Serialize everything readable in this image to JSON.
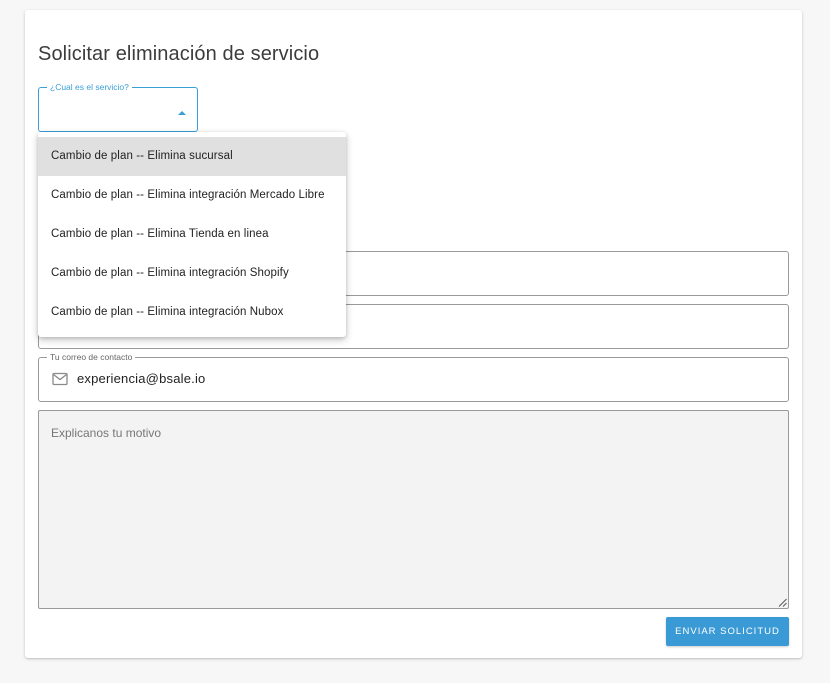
{
  "form": {
    "title": "Solicitar eliminación de servicio",
    "service_label": "¿Cual es el servicio?",
    "service_value": "",
    "field_a_value": "",
    "field_b_value": "",
    "email_label": "Tu correo de contacto",
    "email_value": "experiencia@bsale.io",
    "reason_placeholder": "Explicanos tu motivo",
    "submit_label": "ENVIAR SOLICITUD"
  },
  "dropdown": {
    "options": [
      "Cambio de plan -- Elimina sucursal",
      "Cambio de plan -- Elimina integración Mercado Libre",
      "Cambio de plan -- Elimina Tienda en linea",
      "Cambio de plan -- Elimina integración Shopify",
      "Cambio de plan -- Elimina integración Nubox"
    ],
    "highlighted_index": 0
  },
  "icons": {
    "select_caret": "caret-up-icon",
    "email": "mail-icon",
    "resize": "resize-handle-icon"
  },
  "colors": {
    "accent": "#3a9fd6",
    "button": "#3a9ad5",
    "highlight": "#e0e0e0",
    "textarea_bg": "#f3f3f3"
  }
}
